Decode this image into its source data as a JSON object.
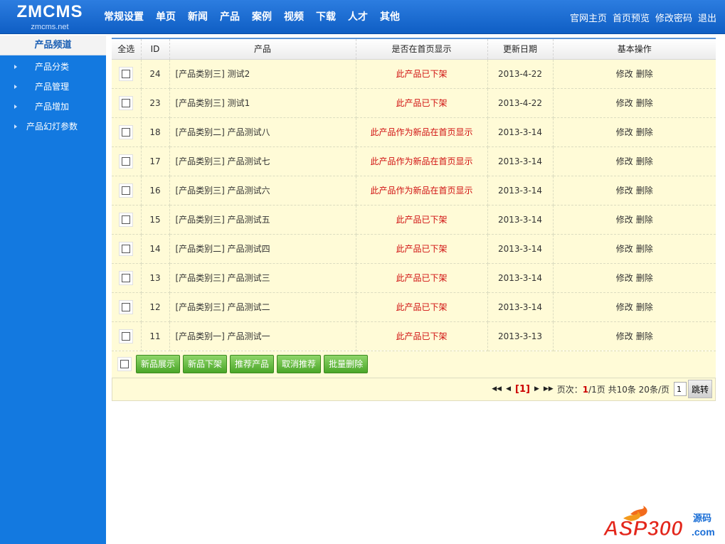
{
  "logo": {
    "main": "ZMCMS",
    "sub": "zmcms.net"
  },
  "nav": [
    "常规设置",
    "单页",
    "新闻",
    "产品",
    "案例",
    "视频",
    "下载",
    "人才",
    "其他"
  ],
  "toplinks": [
    "官网主页",
    "首页预览",
    "修改密码",
    "退出"
  ],
  "sidebar": {
    "title": "产品频道",
    "items": [
      {
        "label": "产品分类"
      },
      {
        "label": "产品管理"
      },
      {
        "label": "产品增加"
      },
      {
        "label": "产品幻灯参数"
      }
    ]
  },
  "table": {
    "headers": [
      "全选",
      "ID",
      "产品",
      "是否在首页显示",
      "更新日期",
      "基本操作"
    ],
    "rows": [
      {
        "id": "24",
        "name": "[产品类别三] 测试2",
        "status": "此产品已下架",
        "date": "2013-4-22"
      },
      {
        "id": "23",
        "name": "[产品类别三] 测试1",
        "status": "此产品已下架",
        "date": "2013-4-22"
      },
      {
        "id": "18",
        "name": "[产品类别二] 产品测试八",
        "status": "此产品作为新品在首页显示",
        "date": "2013-3-14"
      },
      {
        "id": "17",
        "name": "[产品类别三] 产品测试七",
        "status": "此产品作为新品在首页显示",
        "date": "2013-3-14"
      },
      {
        "id": "16",
        "name": "[产品类别三] 产品测试六",
        "status": "此产品作为新品在首页显示",
        "date": "2013-3-14"
      },
      {
        "id": "15",
        "name": "[产品类别三] 产品测试五",
        "status": "此产品已下架",
        "date": "2013-3-14"
      },
      {
        "id": "14",
        "name": "[产品类别二] 产品测试四",
        "status": "此产品已下架",
        "date": "2013-3-14"
      },
      {
        "id": "13",
        "name": "[产品类别三] 产品测试三",
        "status": "此产品已下架",
        "date": "2013-3-14"
      },
      {
        "id": "12",
        "name": "[产品类别三] 产品测试二",
        "status": "此产品已下架",
        "date": "2013-3-14"
      },
      {
        "id": "11",
        "name": "[产品类别一] 产品测试一",
        "status": "此产品已下架",
        "date": "2013-3-13"
      }
    ],
    "edit_label": "修改",
    "delete_label": "删除"
  },
  "actions": [
    "新品展示",
    "新品下架",
    "推荐产品",
    "取消推荐",
    "批量删除"
  ],
  "pager": {
    "current": "[1]",
    "label_prefix": "页次：",
    "current_page": "1",
    "summary": "/1页 共10条 20条/页",
    "input_value": "1",
    "go_label": "跳转"
  },
  "watermark": {
    "brand": "ASP300",
    "suffix": "源码",
    "domain": ".com"
  },
  "colors": {
    "header": "#1a6ed6",
    "sidebar": "#1379e0",
    "row_bg": "#fffbd7",
    "status_red": "#d01010",
    "button_green": "#4aa628"
  },
  "icons": [
    "first-page-icon",
    "prev-page-icon",
    "next-page-icon",
    "last-page-icon",
    "sidebar-arrow-icon"
  ]
}
